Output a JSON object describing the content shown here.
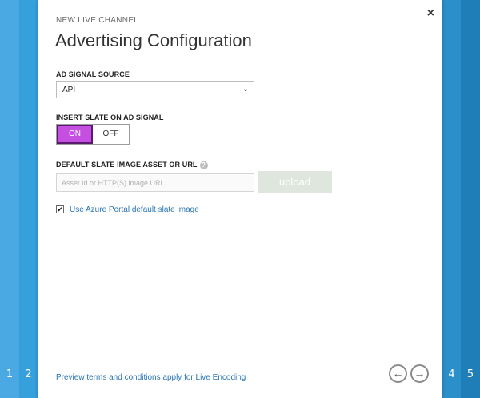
{
  "steps": [
    "1",
    "2",
    "4",
    "5"
  ],
  "dialog": {
    "subtitle": "NEW LIVE CHANNEL",
    "title": "Advertising Configuration",
    "close_icon": "×"
  },
  "ad_signal": {
    "label": "AD SIGNAL SOURCE",
    "selected": "API",
    "chevron": "⌄"
  },
  "insert_slate": {
    "label": "INSERT SLATE ON AD SIGNAL",
    "on_label": "ON",
    "off_label": "OFF",
    "value": "ON"
  },
  "default_slate": {
    "label": "DEFAULT SLATE IMAGE ASSET OR URL",
    "help": "?",
    "placeholder": "Asset Id or HTTP(S) image URL",
    "upload_label": "upload"
  },
  "use_default": {
    "checked_mark": "✔",
    "label": "Use Azure Portal default slate image"
  },
  "footer": {
    "link": "Preview terms and conditions apply for Live Encoding",
    "prev_icon": "←",
    "next_icon": "→"
  },
  "colors": {
    "toggle_on": "#c54fe0",
    "link": "#2a75b5",
    "step_blue": "#35a0dc"
  }
}
